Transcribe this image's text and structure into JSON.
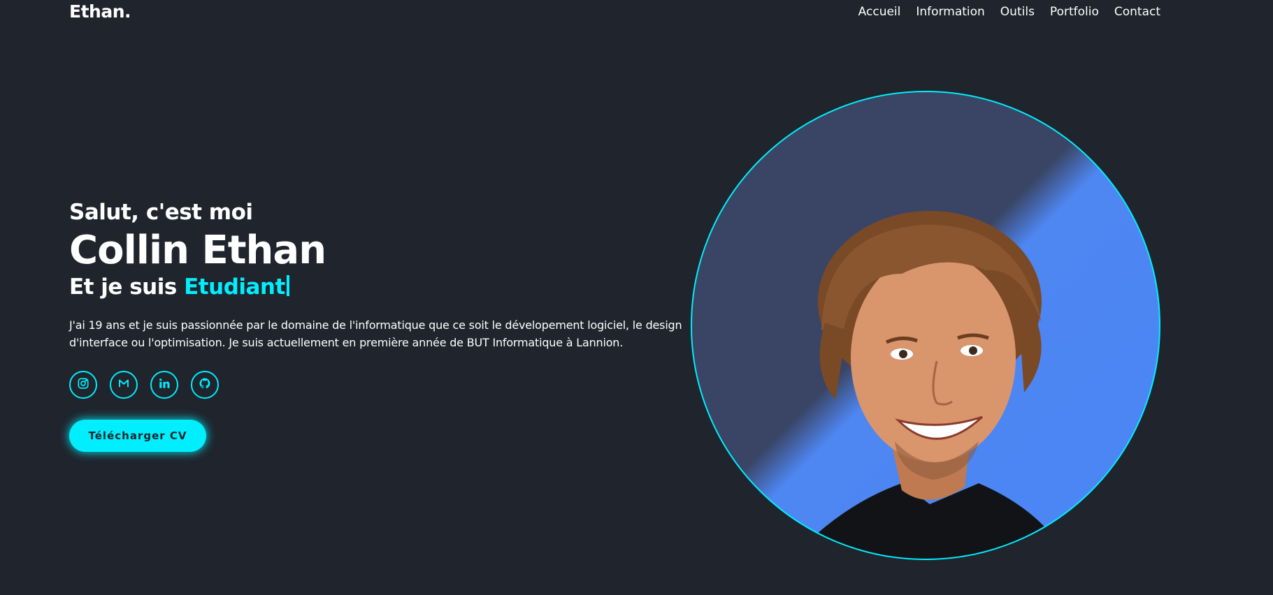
{
  "header": {
    "logo": "Ethan.",
    "nav": [
      {
        "label": "Accueil"
      },
      {
        "label": "Information"
      },
      {
        "label": "Outils"
      },
      {
        "label": "Portfolio"
      },
      {
        "label": "Contact"
      }
    ]
  },
  "hero": {
    "greeting": "Salut, c'est moi",
    "name": "Collin Ethan",
    "role_prefix": "Et je suis ",
    "role_value": "Etudiant",
    "bio": "J'ai 19 ans et je suis passionnée par le domaine de l'informatique que ce soit le dévelopement logiciel, le design d'interface ou l'optimisation. Je suis actuellement en première année de BUT Informatique à Lannion.",
    "socials": [
      {
        "icon": "instagram-icon"
      },
      {
        "icon": "gmail-icon"
      },
      {
        "icon": "linkedin-icon"
      },
      {
        "icon": "github-icon"
      }
    ],
    "cv_button": "Télécharger CV"
  },
  "colors": {
    "background": "#1f242d",
    "accent": "#00eefd",
    "text": "#ffffff",
    "photo_bg_top": "#3a4565",
    "photo_bg_bottom": "#4a86f5"
  }
}
